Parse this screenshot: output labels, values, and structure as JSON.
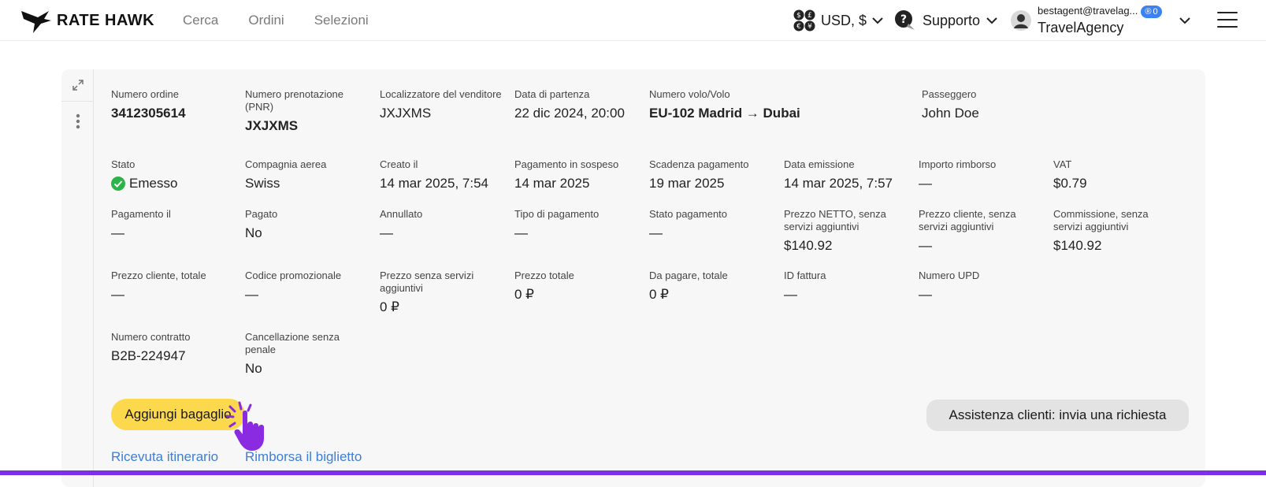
{
  "header": {
    "logo_text": "RATE HAWK",
    "nav": [
      "Cerca",
      "Ordini",
      "Selezioni"
    ],
    "currency": "USD, $",
    "support": "Supporto",
    "user_email": "bestagent@travelag...",
    "badge_count": "0",
    "agency": "TravelAgency"
  },
  "order": {
    "row1": [
      {
        "label": "Numero ordine",
        "value": "3412305614",
        "bold": true
      },
      {
        "label": "Numero prenotazione (PNR)",
        "value": "JXJXMS",
        "bold": true
      },
      {
        "label": "Localizzatore del venditore",
        "value": "JXJXMS"
      },
      {
        "label": "Data di partenza",
        "value": "22 dic 2024, 20:00"
      },
      {
        "label": "Numero volo/Volo",
        "value": "EU-102 Madrid → Dubai",
        "bold": true
      },
      {
        "label": "Passeggero",
        "value": "John Doe"
      }
    ],
    "row2": [
      {
        "label": "Stato",
        "value": "Emesso",
        "status": "ok"
      },
      {
        "label": "Compagnia aerea",
        "value": "Swiss"
      },
      {
        "label": "Creato il",
        "value": "14 mar 2025, 7:54"
      },
      {
        "label": "Pagamento in sospeso",
        "value": "14 mar 2025"
      },
      {
        "label": "Scadenza pagamento",
        "value": "19 mar 2025"
      },
      {
        "label": "Data emissione",
        "value": "14 mar 2025, 7:57"
      },
      {
        "label": "Importo rimborso",
        "value": "—"
      },
      {
        "label": "VAT",
        "value": "$0.79"
      }
    ],
    "row3": [
      {
        "label": "Pagamento il",
        "value": "—"
      },
      {
        "label": "Pagato",
        "value": "No"
      },
      {
        "label": "Annullato",
        "value": "—"
      },
      {
        "label": "Tipo di pagamento",
        "value": "—"
      },
      {
        "label": "Stato pagamento",
        "value": "—"
      },
      {
        "label": "Prezzo NETTO, senza servizi aggiuntivi",
        "value": "$140.92"
      },
      {
        "label": "Prezzo cliente, senza servizi aggiuntivi",
        "value": "—"
      },
      {
        "label": "Commissione, senza servizi aggiuntivi",
        "value": "$140.92"
      }
    ],
    "row4": [
      {
        "label": "Prezzo cliente, totale",
        "value": "—"
      },
      {
        "label": "Codice promozionale",
        "value": "—"
      },
      {
        "label": "Prezzo senza servizi aggiuntivi",
        "value": "0 ₽"
      },
      {
        "label": "Prezzo totale",
        "value": "0 ₽"
      },
      {
        "label": "Da pagare, totale",
        "value": "0 ₽"
      },
      {
        "label": "ID fattura",
        "value": "—"
      },
      {
        "label": "Numero UPD",
        "value": "—"
      }
    ],
    "row5": [
      {
        "label": "Numero contratto",
        "value": "B2B-224947"
      },
      {
        "label": "Cancellazione senza penale",
        "value": "No"
      }
    ]
  },
  "actions": {
    "add_baggage": "Aggiungi bagaglio",
    "support_request": "Assistenza clienti: invia una richiesta",
    "itinerary_receipt": "Ricevuta itinerario",
    "refund_ticket": "Rimborsa il biglietto"
  },
  "colors": {
    "accent_yellow": "#fcd94c",
    "link_blue": "#3d7ed8",
    "status_green": "#2eb24a",
    "pointer_purple": "#8a2be2"
  }
}
